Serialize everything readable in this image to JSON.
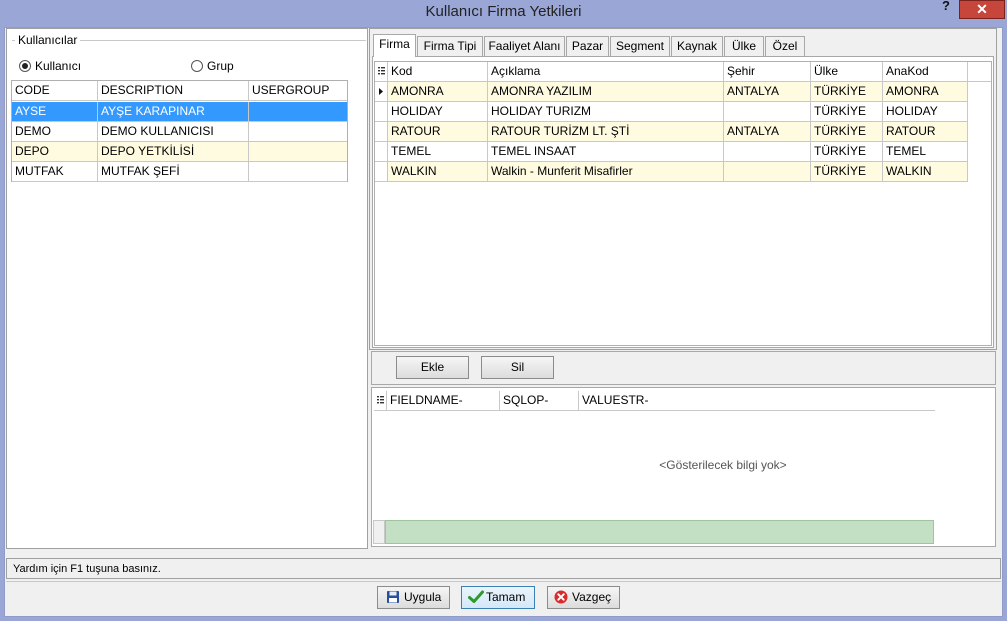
{
  "window": {
    "title": "Kullanıcı Firma Yetkileri",
    "help_label": "?",
    "close_label": "✕"
  },
  "users_panel": {
    "group_label": "Kullanıcılar",
    "radio_user_label": "Kullanıcı",
    "radio_group_label": "Grup",
    "selected_radio": "Kullanıcı",
    "columns": [
      "CODE",
      "DESCRIPTION",
      "USERGROUP"
    ],
    "rows": [
      [
        "AYSE",
        "AYŞE KARAPINAR",
        ""
      ],
      [
        "DEMO",
        "DEMO KULLANICISI",
        ""
      ],
      [
        "DEPO",
        "DEPO YETKİLİSİ",
        ""
      ],
      [
        "MUTFAK",
        "MUTFAK ŞEFİ",
        ""
      ]
    ]
  },
  "tabs": [
    "Firma",
    "Firma Tipi",
    "Faaliyet Alanı",
    "Pazar",
    "Segment",
    "Kaynak",
    "Ülke",
    "Özel"
  ],
  "active_tab": "Firma",
  "firm_grid": {
    "columns": [
      "Kod",
      "Açıklama",
      "Şehir",
      "Ülke",
      "AnaKod"
    ],
    "rows": [
      [
        "AMONRA",
        "AMONRA YAZILIM",
        "ANTALYA",
        "TÜRKİYE",
        "AMONRA"
      ],
      [
        "HOLIDAY",
        "HOLIDAY TURIZM",
        "",
        "TÜRKİYE",
        "HOLIDAY"
      ],
      [
        "RATOUR",
        "RATOUR TURİZM LT. ŞTİ",
        "ANTALYA",
        "TÜRKİYE",
        "RATOUR"
      ],
      [
        "TEMEL",
        "TEMEL INSAAT",
        "",
        "TÜRKİYE",
        "TEMEL"
      ],
      [
        "WALKIN",
        "Walkin - Munferit Misafirler",
        "",
        "TÜRKİYE",
        "WALKIN"
      ]
    ]
  },
  "actions": {
    "add_label": "Ekle",
    "delete_label": "Sil"
  },
  "filter_grid": {
    "columns": [
      "FIELDNAME-",
      "SQLOP-",
      "VALUESTR-"
    ],
    "empty_text": "<Gösterilecek bilgi yok>"
  },
  "status": {
    "text": "Yardım için F1 tuşuna basınız."
  },
  "footer": {
    "apply_label": "Uygula",
    "ok_label": "Tamam",
    "cancel_label": "Vazgeç"
  },
  "icons": {
    "save": "floppy-disk-icon",
    "ok": "check-icon",
    "cancel": "cancel-icon",
    "row_pointer": "row-pointer-icon",
    "column_chooser": "column-chooser-icon"
  },
  "colors": {
    "selection": "#3399ff",
    "alt_row": "#fffbe0",
    "close_button": "#c7463c",
    "title_bar": "#9aa6d6"
  }
}
